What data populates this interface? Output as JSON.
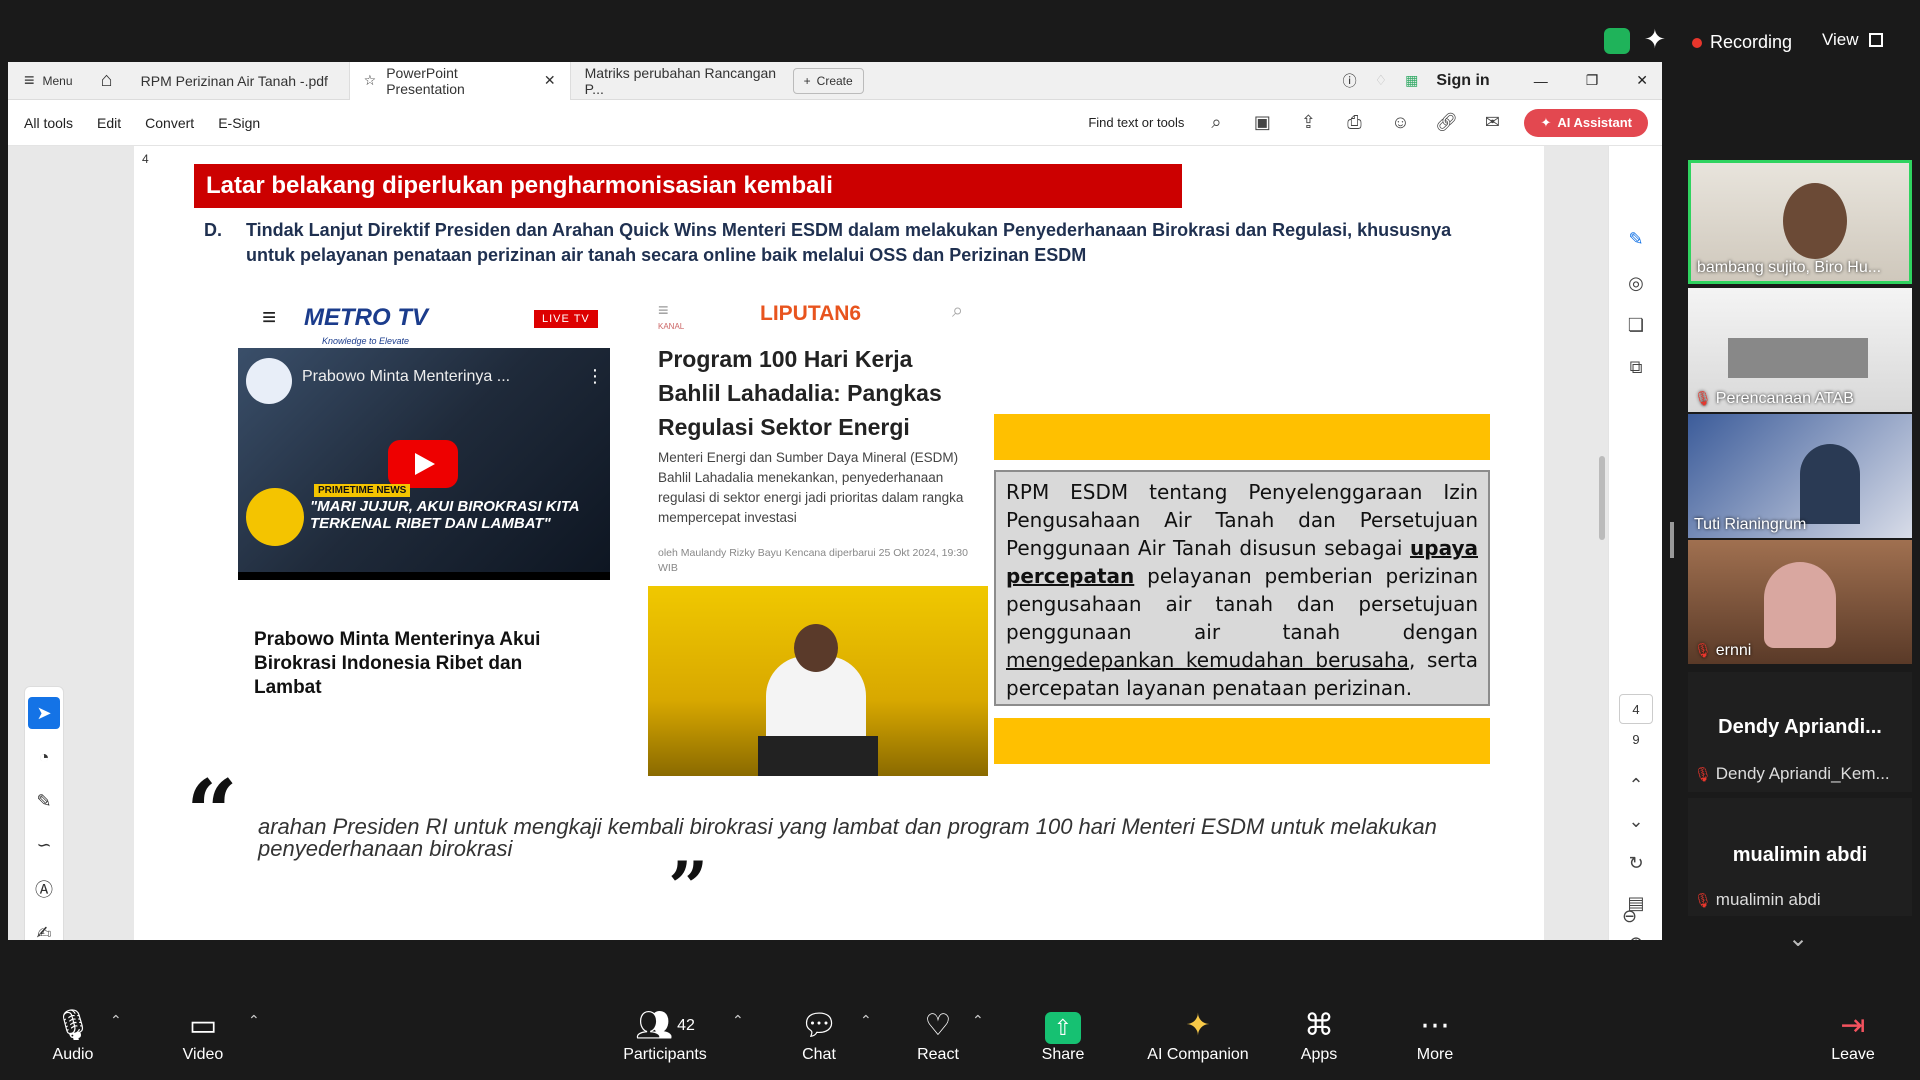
{
  "zoom_top": {
    "recording": "Recording",
    "view": "View"
  },
  "acrobat": {
    "menu": "Menu",
    "tabs": [
      "RPM Perizinan Air Tanah -.pdf",
      "PowerPoint Presentation",
      "Matriks perubahan Rancangan P..."
    ],
    "create": "Create",
    "sign_in": "Sign in",
    "menus": [
      "All tools",
      "Edit",
      "Convert",
      "E-Sign"
    ],
    "find": "Find text or tools",
    "ai_assistant": "AI Assistant",
    "page_current": "4",
    "page_total": "9"
  },
  "slide": {
    "page_number": "4",
    "title": "Latar belakang diperlukan pengharmonisasian kembali",
    "d_label": "D.",
    "d_text": "Tindak Lanjut Direktif Presiden dan Arahan Quick Wins Menteri ESDM dalam melakukan Penyederhanaan Birokrasi dan Regulasi, khususnya untuk pelayanan penataan perizinan air tanah secara online baik melalui OSS dan Perizinan ESDM",
    "metro_logo": "METRO TV",
    "metro_tag": "Knowledge to Elevate",
    "live": "LIVE TV",
    "video_title": "Prabowo Minta Menterinya ...",
    "primetime": "PRIMETIME NEWS",
    "video_quote": "\"MARI JUJUR, AKUI BIROKRASI KITA TERKENAL RIBET DAN LAMBAT\"",
    "metro_caption": "Prabowo Minta Menterinya Akui Birokrasi Indonesia Ribet dan Lambat",
    "kanal": "KANAL",
    "liputan_logo": "LIPUTAN6",
    "liputan_title": "Program 100 Hari Kerja Bahlil Lahadalia: Pangkas Regulasi Sektor Energi",
    "liputan_body": "Menteri Energi dan Sumber Daya Mineral (ESDM) Bahlil Lahadalia menekankan, penyederhanaan regulasi di sektor energi jadi prioritas dalam rangka mempercepat investasi",
    "liputan_author": "oleh Maulandy Rizky Bayu Kencana diperbarui 25 Okt 2024, 19:30 WIB",
    "box_p1": "RPM ESDM tentang Penyelenggaraan Izin Pengusahaan Air Tanah dan Persetujuan Penggunaan Air Tanah disusun sebagai ",
    "box_u1": "upaya percepatan",
    "box_p2": " pelayanan pemberian perizinan pengusahaan air tanah dan persetujuan penggunaan air tanah dengan ",
    "box_u2": "mengedepankan kemudahan berusaha",
    "box_p3": ", serta percepatan layanan penataan perizinan.",
    "quote": "arahan Presiden RI untuk mengkaji kembali birokrasi yang lambat dan program 100 hari Menteri ESDM untuk melakukan penyederhanaan birokrasi"
  },
  "participants": [
    {
      "name": "bambang sujito, Biro Hu..."
    },
    {
      "name": "Perencanaan ATAB"
    },
    {
      "name": "Tuti Rianingrum"
    },
    {
      "name": "ernni"
    }
  ],
  "participants_noncam": [
    {
      "title": "Dendy  Apriandi...",
      "sub": "Dendy Apriandi_Kem..."
    },
    {
      "title": "mualimin abdi",
      "sub": "mualimin abdi"
    }
  ],
  "bottom": {
    "audio": "Audio",
    "video": "Video",
    "participants": "Participants",
    "participants_count": "42",
    "chat": "Chat",
    "react": "React",
    "share": "Share",
    "ai": "AI Companion",
    "apps": "Apps",
    "more": "More",
    "leave": "Leave"
  },
  "colors": {
    "title_red": "#cc0000",
    "accent_yellow": "#ffc000",
    "share_green": "#16c172",
    "ai_red": "#e34850"
  }
}
